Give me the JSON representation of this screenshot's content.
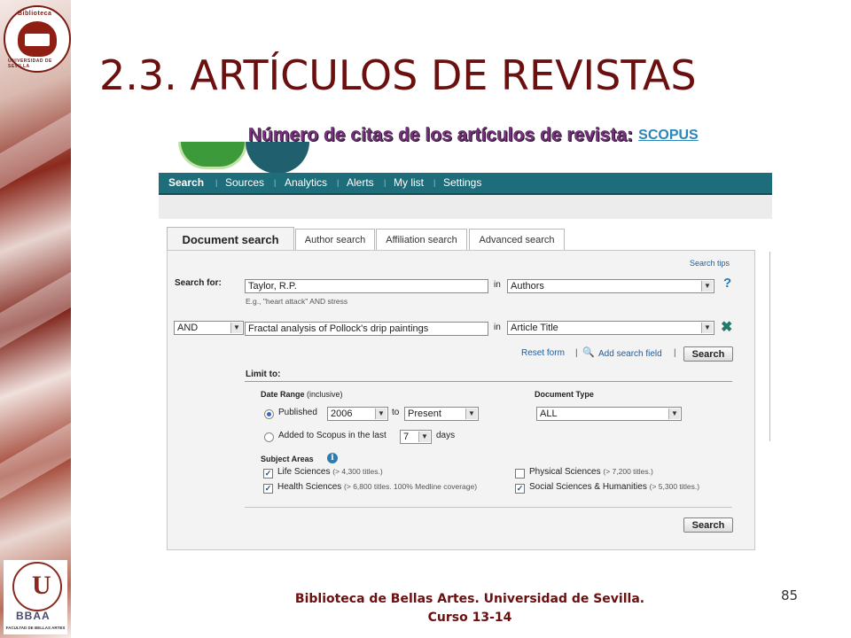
{
  "slide": {
    "title": "2.3.  ARTÍCULOS DE REVISTAS",
    "subtitle_label": "Número de citas de los artículos de revista:",
    "subtitle_link": "SCOPUS",
    "footer_line1": "Biblioteca de Bellas Artes. Universidad de Sevilla.",
    "footer_line2": "Curso 13-14",
    "page_number": "85",
    "logo_top_text": "Biblioteca",
    "logo_bottom_text": "UNIVERSIDAD DE SEVILLA",
    "logo_faculty_text": "FACULTAD DE BELLAS ARTES",
    "logo_faculty_mark": "BBAA"
  },
  "colors": {
    "title": "#6b0f0f",
    "subtitle": "#7b2f82",
    "link": "#2a86b8",
    "navbar": "#1d6d7a"
  },
  "nav": {
    "items": [
      "Search",
      "Sources",
      "Analytics",
      "Alerts",
      "My list",
      "Settings"
    ],
    "active": "Search"
  },
  "tabs": [
    "Document search",
    "Author search",
    "Affiliation search",
    "Advanced search"
  ],
  "form": {
    "search_tips": "Search tips",
    "search_for_label": "Search for:",
    "query1_value": "Taylor, R.P.",
    "query1_hint": "E.g., \"heart attack\" AND stress",
    "in_label": "in",
    "field1_value": "Authors",
    "operator_value": "AND",
    "query2_value": "Fractal analysis of Pollock's drip paintings",
    "field2_value": "Article Title",
    "reset_form": "Reset form",
    "add_field": "Add search field",
    "search_button": "Search",
    "limit_to": "Limit to:",
    "date_range_label": "Date Range",
    "date_range_note": "(inclusive)",
    "published_label": "Published",
    "from_year": "2006",
    "to_label": "to",
    "to_value": "Present",
    "added_label": "Added to Scopus in the last",
    "days_value": "7",
    "days_label": "days",
    "document_type_label": "Document Type",
    "document_type_value": "ALL",
    "subject_areas_label": "Subject Areas",
    "subjects": [
      {
        "name": "Life Sciences",
        "note": "(> 4,300 titles.)",
        "checked": true
      },
      {
        "name": "Health Sciences",
        "note": "(> 6,800 titles. 100% Medline coverage)",
        "checked": true
      },
      {
        "name": "Physical Sciences",
        "note": "(> 7,200 titles.)",
        "checked": false
      },
      {
        "name": "Social Sciences & Humanities",
        "note": "(> 5,300 titles.)",
        "checked": true
      }
    ],
    "bottom_search_button": "Search"
  }
}
